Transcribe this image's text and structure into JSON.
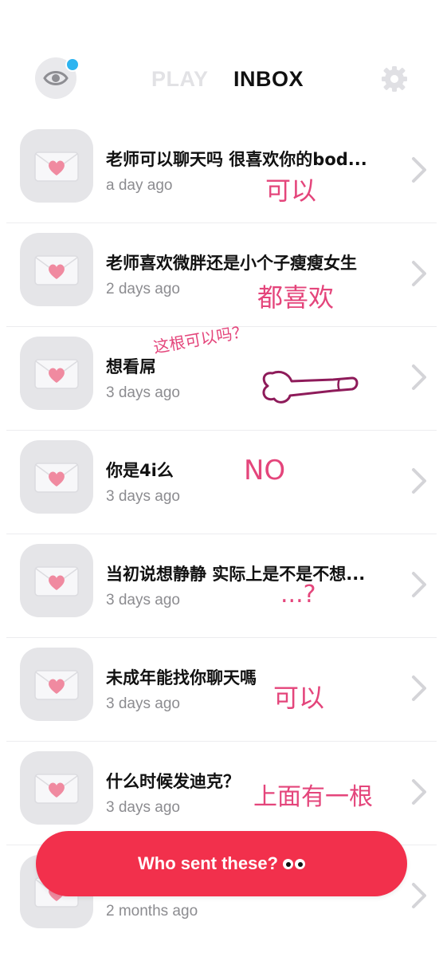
{
  "header": {
    "tabs": [
      {
        "label": "PLAY"
      },
      {
        "label": "INBOX"
      }
    ]
  },
  "messages": [
    {
      "text": "老师可以聊天吗 很喜欢你的bod...",
      "time": "a day ago",
      "reply": "可以"
    },
    {
      "text": "老师喜欢微胖还是小个子瘦瘦女生",
      "time": "2 days ago",
      "reply": "都喜欢"
    },
    {
      "text": "想看屌",
      "time": "3 days ago",
      "reply": "这根可以吗？"
    },
    {
      "text": "你是4i么",
      "time": "3 days ago",
      "reply": "NO"
    },
    {
      "text": "当初说想静静 实际上是不是不想...",
      "time": "3 days ago",
      "reply": "...?"
    },
    {
      "text": "未成年能找你聊天嗎",
      "time": "3 days ago",
      "reply": "可以"
    },
    {
      "text": "什么时候发迪克？",
      "time": "3 days ago",
      "reply": "上面有一根"
    },
    {
      "text": "",
      "time": "2 months ago",
      "reply": ""
    }
  ],
  "cta": {
    "label": "Who sent these?"
  },
  "icons": {
    "eye": "eye-icon",
    "gear": "gear-icon",
    "envelope": "heart-envelope-icon",
    "chevron": "chevron-right-icon",
    "eyes_emoji": "eyes-emoji-icon"
  },
  "colors": {
    "accent": "#f2304c",
    "reply_ink": "#e4457b",
    "doodle": "#8e1b5a",
    "notification_dot": "#2db4f0"
  }
}
